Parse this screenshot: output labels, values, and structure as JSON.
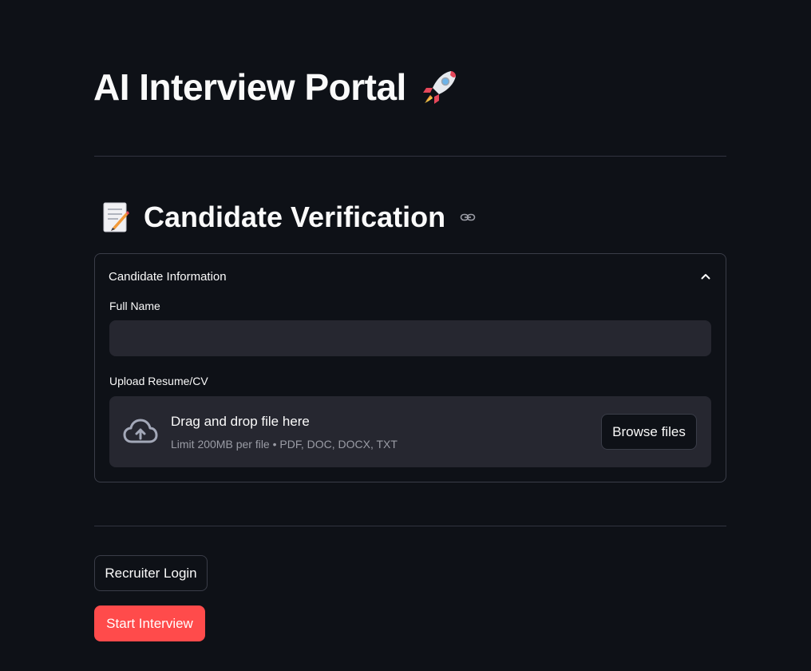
{
  "app": {
    "title": "AI Interview Portal",
    "title_icon": "rocket-icon"
  },
  "section": {
    "heading": "Candidate Verification",
    "heading_icon": "memo-icon",
    "anchor_icon": "link-icon"
  },
  "expander": {
    "label": "Candidate Information",
    "state": "expanded",
    "name_field": {
      "label": "Full Name",
      "value": "",
      "placeholder": ""
    },
    "upload": {
      "label": "Upload Resume/CV",
      "dropzone_title": "Drag and drop file here",
      "dropzone_limit": "Limit 200MB per file • PDF, DOC, DOCX, TXT",
      "browse_label": "Browse files",
      "icon": "cloud-upload-icon"
    }
  },
  "actions": {
    "recruiter_login_label": "Recruiter Login",
    "start_interview_label": "Start Interview"
  },
  "colors": {
    "background": "#0e1117",
    "input_background": "#262730",
    "primary": "#ff4b4b",
    "border": "#3a3d48",
    "text": "#fafafa",
    "muted_text": "#9a9ca5"
  }
}
